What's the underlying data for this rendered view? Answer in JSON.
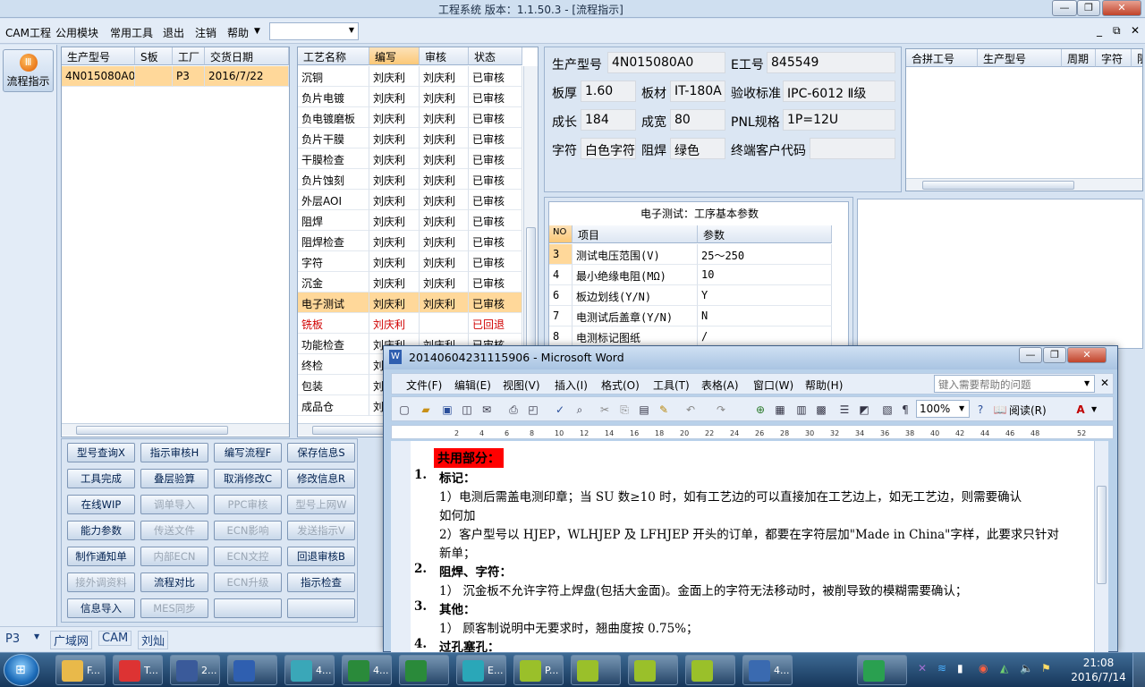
{
  "app": {
    "title": "工程系统   版本：1.1.50.3 - [流程指示]",
    "menu": [
      "CAM工程",
      "公用模块",
      "常用工具",
      "退出",
      "注销",
      "帮助"
    ],
    "menu_dropdown": "",
    "mdi_controls": [
      "_",
      "⧉",
      "✕"
    ]
  },
  "left": {
    "flow_button": "流程指示"
  },
  "orders": {
    "headers": [
      "生产型号",
      "S板",
      "工厂",
      "交货日期"
    ],
    "rows": [
      {
        "model": "4N015080A0",
        "sboard": "",
        "factory": "P3",
        "date": "2016/7/22"
      }
    ]
  },
  "process": {
    "headers": [
      "工艺名称",
      "编写",
      "审核",
      "状态"
    ],
    "rows": [
      [
        "沉铜",
        "刘庆利",
        "刘庆利",
        "已审核"
      ],
      [
        "负片电镀",
        "刘庆利",
        "刘庆利",
        "已审核"
      ],
      [
        "负电镀磨板",
        "刘庆利",
        "刘庆利",
        "已审核"
      ],
      [
        "负片干膜",
        "刘庆利",
        "刘庆利",
        "已审核"
      ],
      [
        "干膜检查",
        "刘庆利",
        "刘庆利",
        "已审核"
      ],
      [
        "负片蚀刻",
        "刘庆利",
        "刘庆利",
        "已审核"
      ],
      [
        "外层AOI",
        "刘庆利",
        "刘庆利",
        "已审核"
      ],
      [
        "阻焊",
        "刘庆利",
        "刘庆利",
        "已审核"
      ],
      [
        "阻焊检查",
        "刘庆利",
        "刘庆利",
        "已审核"
      ],
      [
        "字符",
        "刘庆利",
        "刘庆利",
        "已审核"
      ],
      [
        "沉金",
        "刘庆利",
        "刘庆利",
        "已审核"
      ],
      [
        "电子测试",
        "刘庆利",
        "刘庆利",
        "已审核"
      ],
      [
        "铣板",
        "刘庆利",
        "",
        "已回退"
      ],
      [
        "功能检查",
        "刘庆利",
        "刘庆利",
        "已审核"
      ],
      [
        "终检",
        "刘",
        "",
        ""
      ],
      [
        "包装",
        "刘",
        "",
        ""
      ],
      [
        "成品仓",
        "刘",
        "",
        ""
      ]
    ]
  },
  "info": {
    "labels": {
      "model": "生产型号",
      "e_no": "E工号",
      "thickness": "板厚",
      "material": "板材",
      "standard": "验收标准",
      "length": "成长",
      "width": "成宽",
      "pnl": "PNL规格",
      "char": "字符",
      "mask": "阻焊",
      "customer": "终端客户代码"
    },
    "values": {
      "model": "4N015080A0",
      "e_no": "845549",
      "thickness": "1.60",
      "material": "IT-180A",
      "standard": "IPC-6012 Ⅱ级",
      "length": "184",
      "width": "80",
      "pnl": "1P=12U",
      "char": "白色字符",
      "mask": "绿色",
      "customer": ""
    }
  },
  "merge": {
    "headers": [
      "合拼工号",
      "生产型号",
      "周期",
      "字符",
      "阻"
    ]
  },
  "params": {
    "title": "电子测试：工序基本参数",
    "headers": [
      "NO",
      "项目",
      "参数"
    ],
    "rows": [
      [
        "3",
        "测试电压范围(V)",
        "25～250"
      ],
      [
        "4",
        "最小绝缘电阻(MΩ)",
        "10"
      ],
      [
        "6",
        "板边划线(Y/N)",
        "Y"
      ],
      [
        "7",
        "电测试后盖章(Y/N)",
        "N"
      ],
      [
        "8",
        "电测标记图纸",
        "/"
      ]
    ]
  },
  "buttons": [
    [
      "型号查询X",
      "指示审核H",
      "编写流程F",
      "保存信息S"
    ],
    [
      "工具完成",
      "叠层验算",
      "取消修改C",
      "修改信息R"
    ],
    [
      "在线WIP",
      "调单导入",
      "PPC审核",
      "型号上网W"
    ],
    [
      "能力参数",
      "传送文件",
      "ECN影响",
      "发送指示V"
    ],
    [
      "制作通知单",
      "内部ECN",
      "ECN文控",
      "回退审核B"
    ],
    [
      "接外调资料",
      "流程对比",
      "ECN升级",
      "指示检查"
    ],
    [
      "信息导入",
      "MES同步",
      "",
      ""
    ]
  ],
  "buttons_disabled": [
    [
      false,
      false,
      false,
      false
    ],
    [
      false,
      false,
      false,
      false
    ],
    [
      false,
      true,
      true,
      true
    ],
    [
      false,
      true,
      true,
      true
    ],
    [
      false,
      true,
      true,
      false
    ],
    [
      true,
      false,
      true,
      false
    ],
    [
      false,
      true,
      false,
      false
    ]
  ],
  "status_tabs": [
    "P3",
    "广域网",
    "CAM",
    "刘灿"
  ],
  "word": {
    "title": "20140604231115906 - Microsoft Word",
    "menu": [
      "文件(F)",
      "编辑(E)",
      "视图(V)",
      "插入(I)",
      "格式(O)",
      "工具(T)",
      "表格(A)",
      "窗口(W)",
      "帮助(H)"
    ],
    "help_placeholder": "键入需要帮助的问题",
    "zoom": "100%",
    "read_button": "阅读(R)",
    "ruler": [
      "2",
      "4",
      "6",
      "8",
      "10",
      "12",
      "14",
      "16",
      "18",
      "20",
      "22",
      "24",
      "26",
      "28",
      "30",
      "32",
      "34",
      "36",
      "38",
      "40",
      "42",
      "44",
      "46",
      "48",
      "52"
    ],
    "doc": {
      "heading": "共用部分：",
      "items": [
        {
          "no": "1.",
          "title": "标记："
        },
        {
          "text": "1）电测后需盖电测印章；当 SU 数≥10 时，如有工艺边的可以直接加在工艺边上，如无工艺边，则需要确认"
        },
        {
          "text": "如何加"
        },
        {
          "text": "2）客户型号以 HJEP，WLHJEP 及 LFHJEP 开头的订单，都要在字符层加\"Made in China\"字样，此要求只针对"
        },
        {
          "text": "新单；"
        },
        {
          "no": "2.",
          "title": "阻焊、字符："
        },
        {
          "text": "1） 沉金板不允许字符上焊盘(包括大金面)。金面上的字符无法移动时，被削导致的模糊需要确认；"
        },
        {
          "no": "3.",
          "title": "其他："
        },
        {
          "text": "1） 顾客制说明中无要求时，翘曲度按 0.75%；"
        },
        {
          "no": "4.",
          "title": "过孔塞孔："
        }
      ]
    }
  },
  "taskbar": {
    "tasks": [
      "F...",
      "T...",
      "2...",
      "",
      "4...",
      "4...",
      "",
      "E...",
      "P...",
      "",
      "",
      "",
      "4...",
      ""
    ],
    "clock_time": "21:08",
    "clock_date": "2016/7/14"
  },
  "colors": {
    "selected_row": "#ffd89a",
    "returned": "#d00000",
    "heading_bg": "#ff0000"
  }
}
